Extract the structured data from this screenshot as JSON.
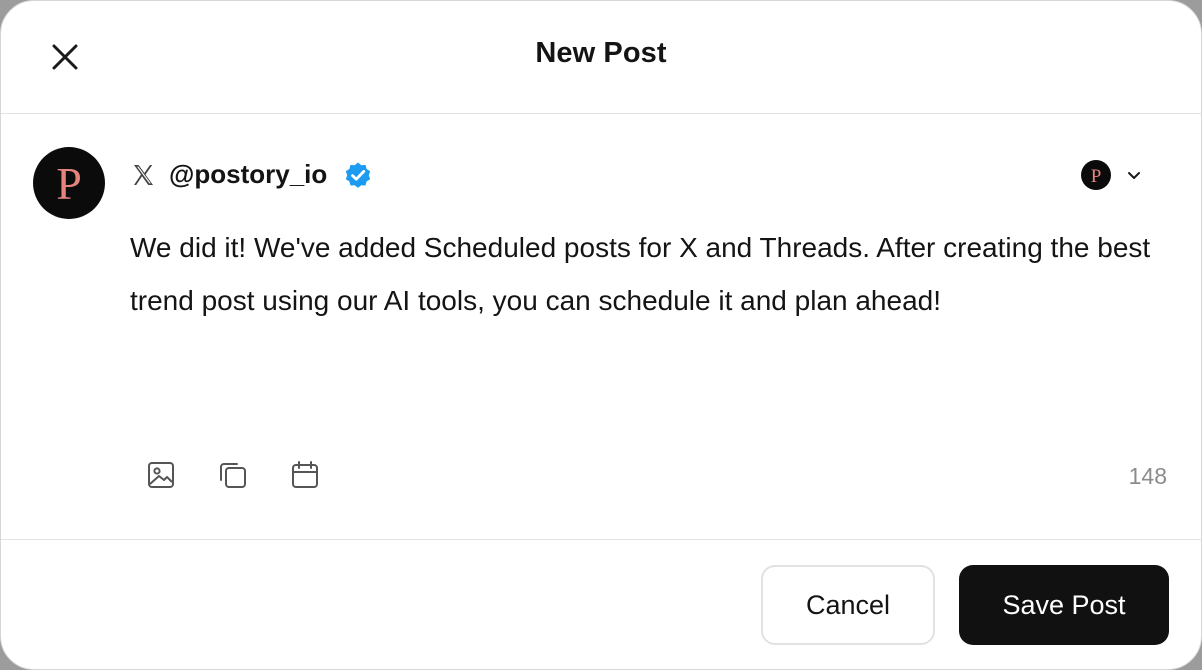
{
  "header": {
    "title": "New Post"
  },
  "account": {
    "platform_icon": "x-logo-icon",
    "handle": "@postory_io",
    "verified": true,
    "avatar_letter": "P",
    "verified_color": "#1d9bf0",
    "avatar_bg": "#0b0b0b",
    "avatar_letter_color": "#e4847c"
  },
  "post": {
    "text": "We did it! We've added Scheduled posts for X and Threads. After creating the best trend post using our AI tools, you can schedule it and plan ahead!",
    "char_count": "148"
  },
  "toolbar": {
    "icons": [
      "image-icon",
      "copy-icon",
      "calendar-icon"
    ]
  },
  "footer": {
    "cancel_label": "Cancel",
    "save_label": "Save Post"
  }
}
